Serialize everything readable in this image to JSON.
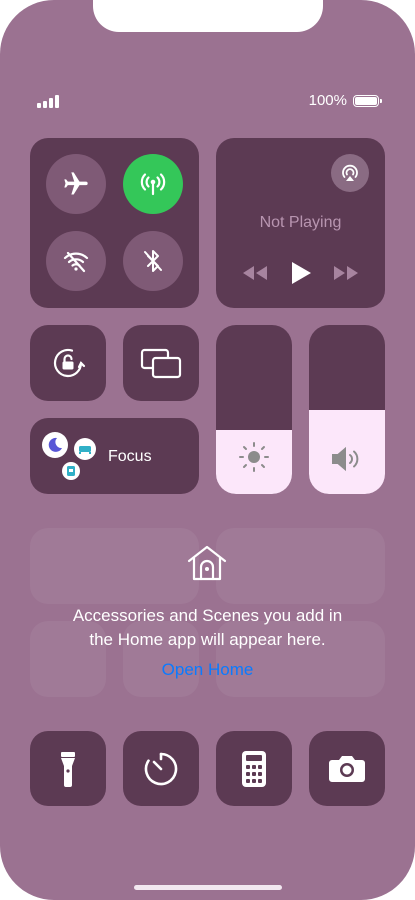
{
  "status": {
    "battery_text": "100%"
  },
  "connectivity": {
    "airplane_mode": "off",
    "cellular_data": "on",
    "wifi": "off",
    "bluetooth": "off"
  },
  "now_playing": {
    "title": "Not Playing"
  },
  "sliders": {
    "brightness_level": 0.38,
    "volume_level": 0.5
  },
  "focus": {
    "label": "Focus"
  },
  "home": {
    "message_line1": "Accessories and Scenes you add in",
    "message_line2": "the Home app will appear here.",
    "open_link": "Open Home"
  },
  "colors": {
    "background": "#9b7291",
    "tile": "#5c3a53",
    "active_green": "#34c759",
    "link_blue": "#0a7aff"
  }
}
